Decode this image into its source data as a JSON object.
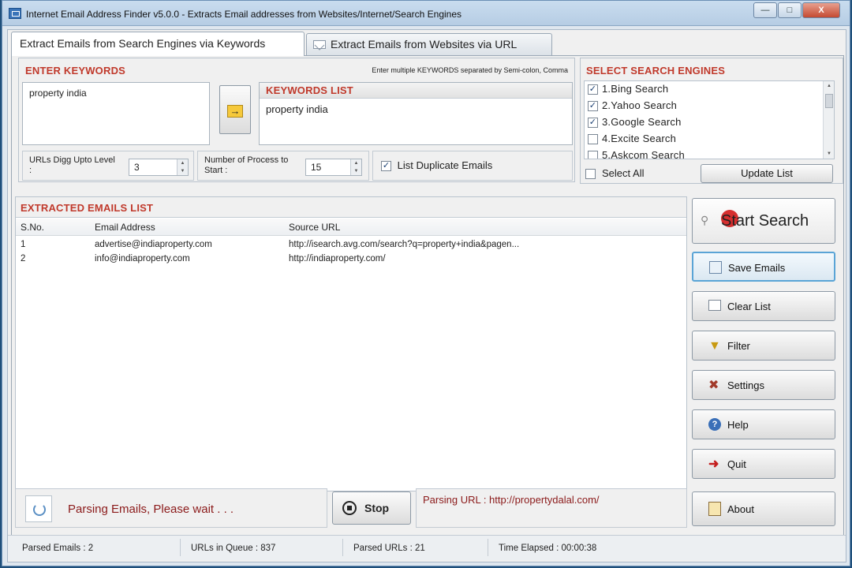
{
  "window": {
    "title": "Internet Email Address Finder v5.0.0 - Extracts Email addresses from Websites/Internet/Search Engines",
    "min_label": "—",
    "max_label": "□",
    "close_label": "X"
  },
  "tabs": [
    {
      "label": "Extract Emails from Search Engines via Keywords",
      "active": true
    },
    {
      "label": "Extract Emails from Websites via URL",
      "active": false
    }
  ],
  "keywords": {
    "heading": "ENTER KEYWORDS",
    "hint": "Enter multiple KEYWORDS separated by Semi-colon, Comma",
    "input_value": "property india",
    "arrow_label": "→",
    "list_heading": "KEYWORDS LIST",
    "list_items": [
      "property india"
    ]
  },
  "options": {
    "urls_digg_label": "URLs Digg Upto Level :",
    "urls_digg_value": "3",
    "process_label": "Number of Process to Start :",
    "process_value": "15",
    "duplicate_label": "List Duplicate Emails",
    "duplicate_checked": true
  },
  "search_engines": {
    "heading": "SELECT SEARCH ENGINES",
    "items": [
      {
        "label": "1.Bing Search",
        "checked": true
      },
      {
        "label": "2.Yahoo Search",
        "checked": true
      },
      {
        "label": "3.Google Search",
        "checked": true
      },
      {
        "label": "4.Excite Search",
        "checked": false
      },
      {
        "label": "5.Askcom Search",
        "checked": false
      }
    ],
    "select_all_label": "Select All",
    "update_label": "Update List"
  },
  "emails": {
    "heading": "EXTRACTED EMAILS LIST",
    "columns": [
      "S.No.",
      "Email Address",
      "Source URL"
    ],
    "rows": [
      {
        "sno": "1",
        "email": "advertise@indiaproperty.com",
        "source": "http://isearch.avg.com/search?q=property+india&pagen..."
      },
      {
        "sno": "2",
        "email": "info@indiaproperty.com",
        "source": "http://indiaproperty.com/"
      }
    ]
  },
  "actions": {
    "start_label": "Start Search",
    "save_label": "Save Emails",
    "clear_label": "Clear List",
    "filter_label": "Filter",
    "settings_label": "Settings",
    "help_label": "Help",
    "quit_label": "Quit",
    "about_label": "About"
  },
  "progress": {
    "wait_text": "Parsing Emails, Please wait . . .",
    "stop_label": "Stop",
    "parsing_url_text": "Parsing URL : http://propertydalal.com/"
  },
  "status": {
    "parsed_emails": "Parsed Emails :  2",
    "urls_in_queue": "URLs in Queue :  837",
    "parsed_urls": "Parsed URLs :  21",
    "time_elapsed": "Time Elapsed :   00:00:38"
  },
  "colors": {
    "heading_red": "#c0392b",
    "status_red": "#8b1a1a",
    "save_highlight": "#5aa4d6"
  }
}
